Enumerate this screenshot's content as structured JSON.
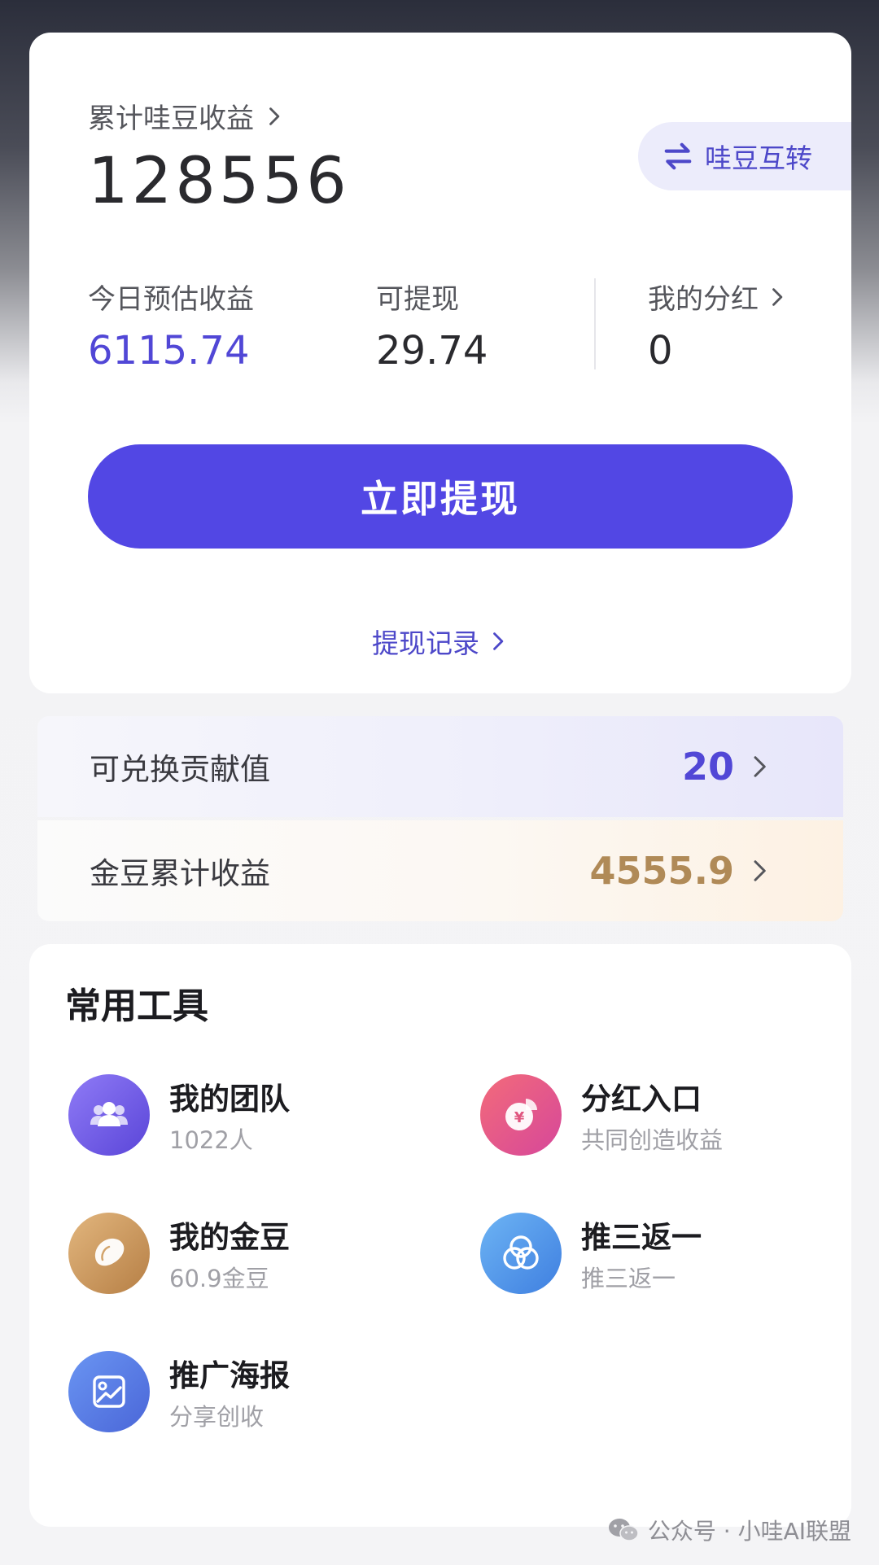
{
  "summary": {
    "total_label": "累计哇豆收益",
    "total_value": "128556",
    "transfer_label": "哇豆互转"
  },
  "stats": [
    {
      "label": "今日预估收益",
      "value": "6115.74"
    },
    {
      "label": "可提现",
      "value": "29.74"
    },
    {
      "label": "我的分红",
      "value": "0"
    }
  ],
  "actions": {
    "withdraw_label": "立即提现",
    "records_label": "提现记录"
  },
  "rows": {
    "contribution": {
      "label": "可兑换贡献值",
      "value": "20"
    },
    "gold": {
      "label": "金豆累计收益",
      "value": "4555.9"
    }
  },
  "tools": {
    "title": "常用工具",
    "items": [
      {
        "name": "我的团队",
        "sub": "1022人",
        "icon": "team-icon"
      },
      {
        "name": "分红入口",
        "sub": "共同创造收益",
        "icon": "dividend-icon"
      },
      {
        "name": "我的金豆",
        "sub": "60.9金豆",
        "icon": "gold-bean-icon"
      },
      {
        "name": "推三返一",
        "sub": "推三返一",
        "icon": "venn-icon"
      },
      {
        "name": "推广海报",
        "sub": "分享创收",
        "icon": "poster-icon"
      }
    ]
  },
  "watermark": {
    "text": "公众号 · 小哇AI联盟"
  },
  "colors": {
    "accent": "#5247e4",
    "accent_text": "#5147d6",
    "gold_text": "#b08a57"
  }
}
